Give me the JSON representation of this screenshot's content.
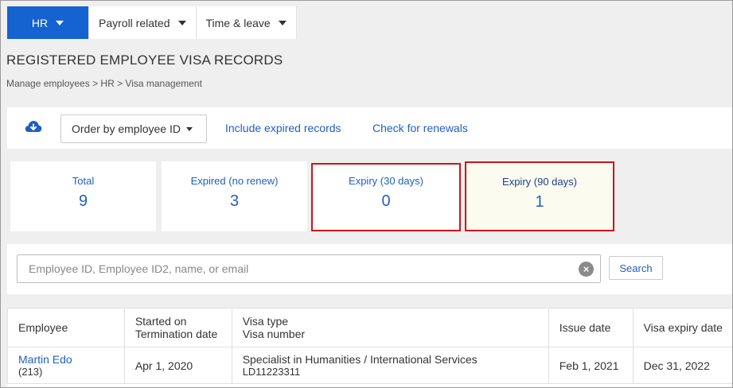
{
  "nav": {
    "items": [
      {
        "label": "HR"
      },
      {
        "label": "Payroll related"
      },
      {
        "label": "Time & leave"
      }
    ]
  },
  "page": {
    "title": "REGISTERED EMPLOYEE VISA RECORDS",
    "breadcrumb": "Manage employees > HR > Visa management"
  },
  "toolbar": {
    "order_label": "Order by employee ID",
    "include_expired": "Include expired records",
    "check_renewals": "Check for renewals"
  },
  "cards": [
    {
      "label": "Total",
      "value": "9"
    },
    {
      "label": "Expired (no renew)",
      "value": "3"
    },
    {
      "label": "Expiry (30 days)",
      "value": "0"
    },
    {
      "label": "Expiry (90 days)",
      "value": "1"
    }
  ],
  "search": {
    "placeholder": "Employee ID, Employee ID2, name, or email",
    "value": "",
    "button": "Search"
  },
  "table": {
    "headers": [
      {
        "l1": "Employee",
        "l2": ""
      },
      {
        "l1": "Started on",
        "l2": "Termination date"
      },
      {
        "l1": "Visa type",
        "l2": "Visa number"
      },
      {
        "l1": "Issue date",
        "l2": ""
      },
      {
        "l1": "Visa expiry date",
        "l2": ""
      }
    ],
    "rows": [
      {
        "employee_name": "Martin Edo",
        "employee_id": "(213)",
        "started": "Apr 1, 2020",
        "visa_type": "Specialist in Humanities / International Services",
        "visa_number": "LD11223311",
        "issue_date": "Feb 1, 2021",
        "expiry_date": "Dec 31, 2022"
      }
    ]
  },
  "colors": {
    "accent": "#1563d0",
    "link": "#1f5fc4",
    "highlight_border": "#d0121b"
  }
}
